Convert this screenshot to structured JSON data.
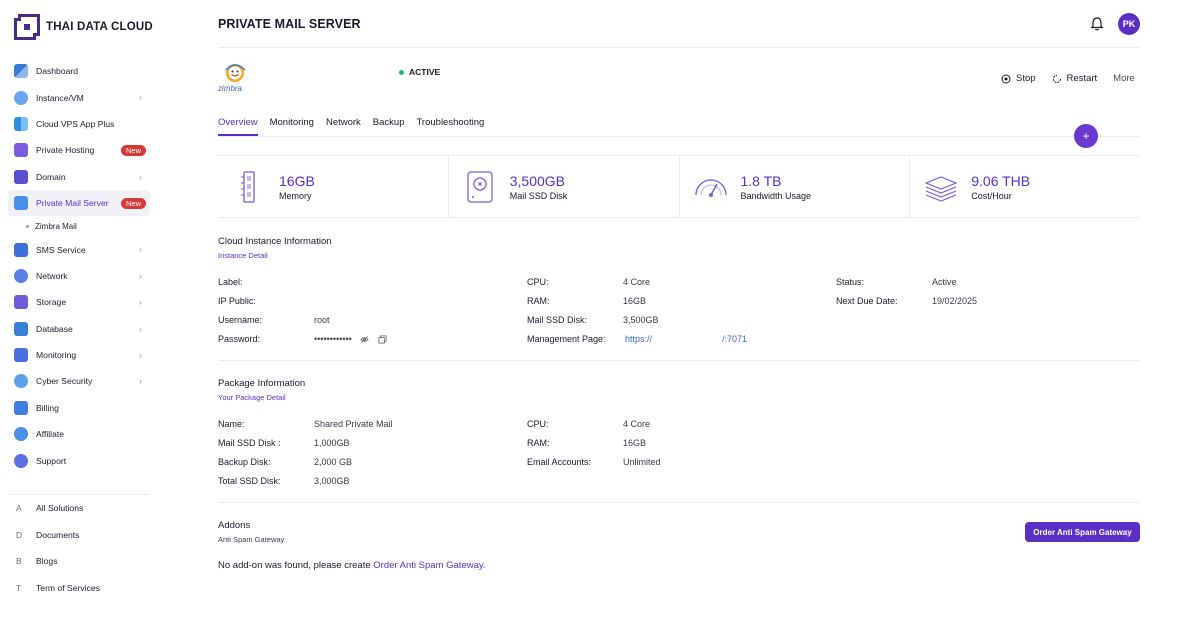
{
  "brand": {
    "name": "THAI DATA CLOUD"
  },
  "sidebar": {
    "items": [
      {
        "label": "Dashboard",
        "icon": "dashboard-icon"
      },
      {
        "label": "Instance/VM",
        "icon": "cloud-icon",
        "chevron": true
      },
      {
        "label": "Cloud VPS App Plus",
        "icon": "apps-icon"
      },
      {
        "label": "Private Hosting",
        "icon": "hosting-icon",
        "badge": "New"
      },
      {
        "label": "Domain",
        "icon": "domain-icon",
        "chevron": true
      },
      {
        "label": "Private Mail Server",
        "icon": "mail-icon",
        "badge": "New",
        "active": true
      },
      {
        "label": "SMS Service",
        "icon": "sms-icon",
        "chevron": true
      },
      {
        "label": "Network",
        "icon": "network-icon",
        "chevron": true
      },
      {
        "label": "Storage",
        "icon": "storage-icon",
        "chevron": true
      },
      {
        "label": "Database",
        "icon": "database-icon",
        "chevron": true
      },
      {
        "label": "Monitoring",
        "icon": "monitoring-icon",
        "chevron": true
      },
      {
        "label": "Cyber Security",
        "icon": "security-icon",
        "chevron": true
      },
      {
        "label": "Billing",
        "icon": "billing-icon"
      },
      {
        "label": "Affiliate",
        "icon": "affiliate-icon"
      },
      {
        "label": "Support",
        "icon": "support-icon"
      }
    ],
    "sub_item": "Zimbra Mail",
    "footer": [
      {
        "letter": "A",
        "label": "All Solutions"
      },
      {
        "letter": "D",
        "label": "Documents"
      },
      {
        "letter": "B",
        "label": "Blogs"
      },
      {
        "letter": "T",
        "label": "Term of Services"
      }
    ]
  },
  "header": {
    "title": "PRIVATE MAIL SERVER",
    "avatar": "PK"
  },
  "product": {
    "logo_text": "zimbra",
    "status": "ACTIVE"
  },
  "actions": {
    "stop": "Stop",
    "restart": "Restart",
    "more": "More"
  },
  "tabs": [
    "Overview",
    "Monitoring",
    "Network",
    "Backup",
    "Troubleshooting"
  ],
  "fab": "+",
  "stats": [
    {
      "value": "16GB",
      "label": "Memory",
      "icon": "memory-icon"
    },
    {
      "value": "3,500GB",
      "label": "Mail SSD Disk",
      "icon": "disk-icon"
    },
    {
      "value": "1.8 TB",
      "label": "Bandwidth Usage",
      "icon": "gauge-icon"
    },
    {
      "value": "9.06 THB",
      "label": "Cost/Hour",
      "icon": "money-icon"
    }
  ],
  "instance": {
    "title": "Cloud Instance Information",
    "subtitle": "Instance Detail",
    "label_key": "Label:",
    "ip_key": "IP Public:",
    "username_key": "Username:",
    "username": "root",
    "password_key": "Password:",
    "password": "••••••••••••",
    "cpu_key": "CPU:",
    "cpu": "4 Core",
    "ram_key": "RAM:",
    "ram": "16GB",
    "disk_key": "Mail SSD Disk:",
    "disk": "3,500GB",
    "mgmt_key": "Management Page:",
    "mgmt_a": "https://",
    "mgmt_b": "/:7071",
    "status_key": "Status:",
    "status": "Active",
    "due_key": "Next Due Date:",
    "due": "19/02/2025"
  },
  "package": {
    "title": "Package Information",
    "subtitle": "Your Package Detail",
    "name_key": "Name:",
    "name": "Shared Private Mail",
    "disk_key": "Mail SSD Disk :",
    "disk": "1,000GB",
    "backup_key": "Backup Disk:",
    "backup": "2,000 GB",
    "total_key": "Total SSD Disk:",
    "total": "3,000GB",
    "cpu_key": "CPU:",
    "cpu": "4 Core",
    "ram_key": "RAM:",
    "ram": "16GB",
    "email_key": "Email Accounts:",
    "email": "Unlimited"
  },
  "addons": {
    "title": "Addons",
    "subtitle": "Anti Spam Gateway",
    "button": "Order Anti Spam Gateway",
    "empty_text": "No add-on was found, please create ",
    "empty_link": "Order Anti Spam Gateway."
  },
  "colors": {
    "accent": "#5b2fc4",
    "active_dot": "#2bb673",
    "badge": "#d83a3a"
  }
}
